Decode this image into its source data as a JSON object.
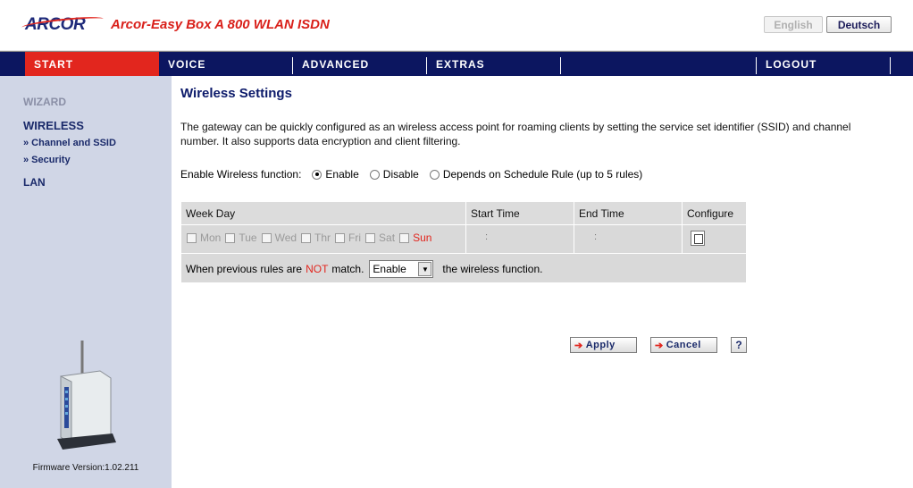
{
  "header": {
    "logo": "ARCOR",
    "product_name": "Arcor-Easy Box A 800 WLAN ISDN",
    "lang_english": "English",
    "lang_deutsch": "Deutsch"
  },
  "nav": {
    "start": "START",
    "voice": "VOICE",
    "advanced": "ADVANCED",
    "extras": "EXTRAS",
    "logout": "LOGOUT"
  },
  "sidebar": {
    "wizard": "WIZARD",
    "wireless": "WIRELESS",
    "channel_ssid": "» Channel and SSID",
    "security": "» Security",
    "lan": "LAN",
    "firmware": "Firmware Version:1.02.211"
  },
  "main": {
    "title": "Wireless Settings",
    "description": "The gateway can be quickly configured as an wireless access point for roaming clients by setting the service set identifier (SSID) and channel number. It also supports data encryption and client filtering.",
    "enable_label": "Enable Wireless function:",
    "options": {
      "enable": "Enable",
      "disable": "Disable",
      "schedule": "Depends on Schedule Rule (up to 5 rules)"
    },
    "selected_option": "enable",
    "table": {
      "headers": {
        "week_day": "Week Day",
        "start_time": "Start Time",
        "end_time": "End Time",
        "configure": "Configure"
      },
      "days": [
        "Mon",
        "Tue",
        "Wed",
        "Thr",
        "Fri",
        "Sat",
        "Sun"
      ],
      "time_sep": ":",
      "prev_text_a": "When previous rules are",
      "prev_not": "NOT",
      "prev_text_b": "match.",
      "prev_select_value": "Enable",
      "prev_text_c": "the wireless function."
    },
    "buttons": {
      "apply": "Apply",
      "cancel": "Cancel",
      "help": "?"
    }
  },
  "colors": {
    "nav_bg": "#0c1660",
    "accent_red": "#e2261e",
    "sidebar_bg": "#d0d6e6"
  }
}
